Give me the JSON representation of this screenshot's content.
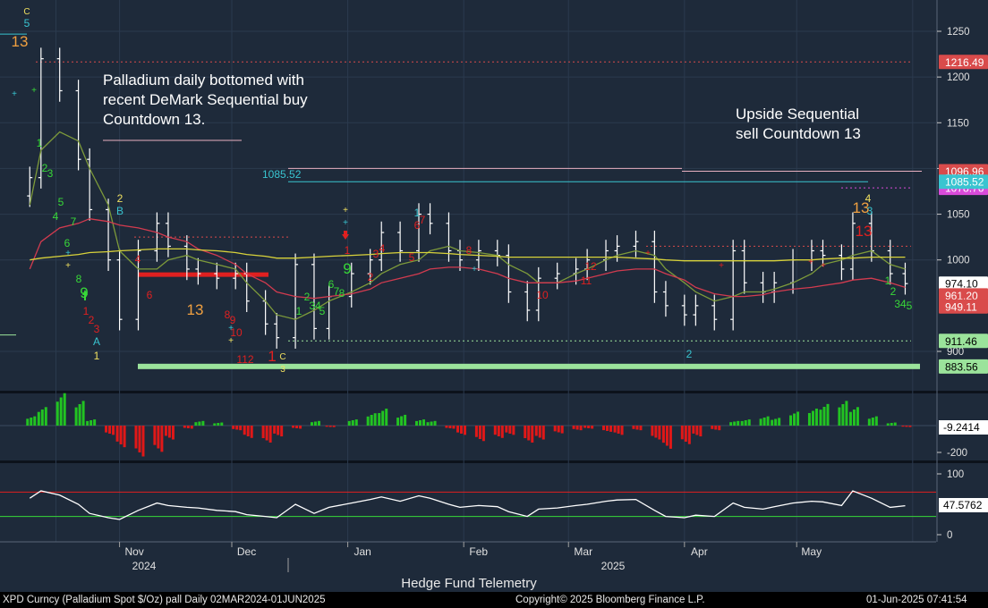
{
  "colors": {
    "background": "#1e2a3a",
    "price_bars": "#ffffff",
    "ma_short": "#7d9a3a",
    "ma_mid": "#d23b4f",
    "ma_long": "#d8d23a",
    "support": "#9be39b",
    "resistance": "#d94b4b",
    "level_magenta": "#d94bd9",
    "level_cyan": "#39c4d0",
    "hist_pos": "#22c322",
    "hist_neg": "#e01818",
    "rsi_line": "#ffffff"
  },
  "chart_data": [
    {
      "type": "ohlc",
      "title": "",
      "xlabel": "",
      "ylabel": "",
      "ylim": [
        885,
        1285
      ],
      "y_ticks": [
        900,
        1000,
        1050,
        1100,
        1150,
        1200,
        1250
      ],
      "x_month_labels": [
        "Nov",
        "Dec",
        "Jan",
        "Feb",
        "Mar",
        "Apr",
        "May"
      ],
      "x_year_labels": [
        "2024",
        "2025"
      ],
      "grid": true,
      "x": [
        "2024-10-08",
        "2024-10-11",
        "2024-10-16",
        "2024-10-21",
        "2024-10-24",
        "2024-10-29",
        "2024-11-01",
        "2024-11-06",
        "2024-11-11",
        "2024-11-14",
        "2024-11-19",
        "2024-11-22",
        "2024-11-27",
        "2024-12-02",
        "2024-12-05",
        "2024-12-10",
        "2024-12-13",
        "2024-12-18",
        "2024-12-23",
        "2024-12-27",
        "2025-01-02",
        "2025-01-07",
        "2025-01-10",
        "2025-01-15",
        "2025-01-20",
        "2025-01-23",
        "2025-01-28",
        "2025-01-31",
        "2025-02-05",
        "2025-02-10",
        "2025-02-13",
        "2025-02-18",
        "2025-02-21",
        "2025-02-26",
        "2025-03-03",
        "2025-03-06",
        "2025-03-11",
        "2025-03-14",
        "2025-03-19",
        "2025-03-24",
        "2025-03-27",
        "2025-04-01",
        "2025-04-04",
        "2025-04-09",
        "2025-04-14",
        "2025-04-17",
        "2025-04-22",
        "2025-04-25",
        "2025-04-30",
        "2025-05-05",
        "2025-05-08",
        "2025-05-13",
        "2025-05-16",
        "2025-05-21",
        "2025-05-26",
        "2025-05-30"
      ],
      "close": [
        1090,
        1220,
        1185,
        1110,
        1055,
        1000,
        935,
        1010,
        1040,
        1015,
        990,
        985,
        980,
        985,
        955,
        930,
        915,
        995,
        925,
        960,
        985,
        1000,
        1030,
        1010,
        1050,
        1040,
        1010,
        1000,
        1010,
        1005,
        965,
        945,
        980,
        985,
        990,
        1000,
        1010,
        1015,
        1020,
        965,
        950,
        940,
        950,
        935,
        1010,
        975,
        965,
        975,
        1000,
        1010,
        1005,
        990,
        1040,
        1010,
        985,
        974.1
      ],
      "series": [
        {
          "name": "",
          "kind": "ma",
          "color_key": "ma_short",
          "values": [
            1060,
            1120,
            1140,
            1130,
            1100,
            1060,
            1010,
            990,
            990,
            1000,
            1005,
            1000,
            995,
            990,
            975,
            955,
            940,
            935,
            945,
            955,
            965,
            975,
            985,
            995,
            1000,
            1010,
            1015,
            1010,
            1008,
            1005,
            995,
            985,
            975,
            975,
            985,
            990,
            1000,
            1005,
            1010,
            1005,
            990,
            975,
            965,
            955,
            960,
            965,
            965,
            968,
            975,
            985,
            995,
            1000,
            1005,
            1010,
            995,
            990
          ]
        },
        {
          "name": "",
          "kind": "ma",
          "color_key": "ma_mid",
          "values": [
            990,
            1020,
            1035,
            1040,
            1045,
            1042,
            1038,
            1035,
            1030,
            1025,
            1020,
            1012,
            1005,
            995,
            985,
            975,
            965,
            960,
            958,
            960,
            963,
            968,
            975,
            980,
            985,
            990,
            992,
            992,
            990,
            985,
            980,
            975,
            975,
            975,
            977,
            980,
            985,
            988,
            990,
            990,
            985,
            978,
            970,
            963,
            960,
            960,
            962,
            965,
            968,
            970,
            972,
            975,
            978,
            980,
            975,
            970
          ]
        },
        {
          "name": "",
          "kind": "ma",
          "color_key": "ma_long",
          "values": [
            1000,
            1002,
            1004,
            1006,
            1008,
            1009,
            1010,
            1011,
            1012,
            1012,
            1012,
            1011,
            1010,
            1008,
            1006,
            1004,
            1002,
            1002,
            1003,
            1004,
            1005,
            1006,
            1007,
            1008,
            1008,
            1008,
            1007,
            1006,
            1005,
            1004,
            1003,
            1003,
            1003,
            1003,
            1003,
            1003,
            1003,
            1003,
            1002,
            1001,
            1000,
            999,
            999,
            999,
            999,
            999,
            999,
            999,
            1000,
            1000,
            1001,
            1002,
            1002,
            1003,
            1003,
            1003
          ]
        }
      ],
      "levels": [
        {
          "value": 1216.49,
          "label": "1216.49",
          "color_key": "resistance"
        },
        {
          "value": 1096.96,
          "label": "1096.96",
          "color_key": "resistance"
        },
        {
          "value": 1078.76,
          "label": "1078.76",
          "color_key": "level_magenta"
        },
        {
          "value": 1085.52,
          "label": "1085.52",
          "color_key": "level_cyan"
        },
        {
          "value": 974.1,
          "label": "974.10",
          "color_key": "price_bars"
        },
        {
          "value": 961.2,
          "label": "961.20",
          "color_key": "resistance"
        },
        {
          "value": 949.11,
          "label": "949.11",
          "color_key": "resistance"
        },
        {
          "value": 911.46,
          "label": "911.46",
          "color_key": "support"
        },
        {
          "value": 883.56,
          "label": "883.56",
          "color_key": "support"
        }
      ],
      "annotations": [
        {
          "text": "Palladium daily bottomed with recent DeMark Sequential buy Countdown 13."
        },
        {
          "text": "Upside Sequential sell Countdown 13"
        }
      ]
    },
    {
      "type": "histogram",
      "title": "",
      "ylim": [
        -200,
        0
      ],
      "y_ticks": [
        -200
      ],
      "last_value_label": "-9.2414",
      "values": [
        60,
        120,
        210,
        160,
        40,
        -60,
        -140,
        -200,
        -170,
        -90,
        -20,
        30,
        20,
        -30,
        -80,
        -110,
        -70,
        -20,
        30,
        -10,
        40,
        80,
        110,
        70,
        40,
        30,
        -20,
        -60,
        -100,
        -80,
        -60,
        -110,
        -90,
        -50,
        -30,
        -20,
        -40,
        -60,
        -30,
        -90,
        -150,
        -120,
        -70,
        -30,
        30,
        40,
        60,
        50,
        90,
        110,
        140,
        160,
        120,
        60,
        20,
        -9.2414
      ]
    },
    {
      "type": "line",
      "title": "",
      "ylim": [
        0,
        100
      ],
      "y_ticks": [
        0,
        100
      ],
      "overbought": 70,
      "oversold": 30,
      "last_value_label": "47.5762",
      "values": [
        60,
        72,
        65,
        50,
        35,
        28,
        25,
        40,
        52,
        48,
        45,
        44,
        40,
        38,
        33,
        30,
        28,
        50,
        35,
        45,
        52,
        58,
        62,
        55,
        64,
        60,
        50,
        45,
        48,
        46,
        38,
        30,
        42,
        44,
        48,
        50,
        55,
        57,
        58,
        40,
        30,
        28,
        32,
        30,
        52,
        45,
        42,
        46,
        52,
        55,
        54,
        48,
        72,
        60,
        45,
        47.5762
      ]
    }
  ],
  "footer": {
    "title": "Hedge Fund Telemetry",
    "left": "XPD Curncy (Palladium Spot  $/Oz) pall  Daily 02MAR2024-01JUN2025",
    "center": "Copyright© 2025 Bloomberg Finance L.P.",
    "right": "01-Jun-2025 07:41:54"
  }
}
